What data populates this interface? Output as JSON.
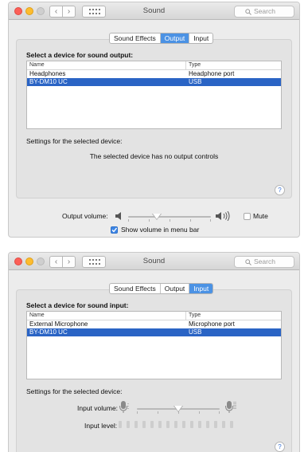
{
  "windows": [
    {
      "title": "Sound",
      "search_placeholder": "Search",
      "tabs": [
        {
          "label": "Sound Effects",
          "selected": false
        },
        {
          "label": "Output",
          "selected": true
        },
        {
          "label": "Input",
          "selected": false
        }
      ],
      "heading": "Select a device for sound output:",
      "columns": [
        "Name",
        "Type"
      ],
      "rows": [
        {
          "name": "Headphones",
          "type": "Headphone port",
          "selected": false
        },
        {
          "name": "BY-DM10 UC",
          "type": "USB",
          "selected": true
        }
      ],
      "settings_label": "Settings for the selected device:",
      "no_controls_text": "The selected device has no output controls",
      "help": "?",
      "output_volume": {
        "label": "Output volume:",
        "level": 0.35
      },
      "mute": {
        "label": "Mute",
        "checked": false
      },
      "show_volume": {
        "label": "Show volume in menu bar",
        "checked": true
      }
    },
    {
      "title": "Sound",
      "search_placeholder": "Search",
      "tabs": [
        {
          "label": "Sound Effects",
          "selected": false
        },
        {
          "label": "Output",
          "selected": false
        },
        {
          "label": "Input",
          "selected": true
        }
      ],
      "heading": "Select a device for sound input:",
      "columns": [
        "Name",
        "Type"
      ],
      "rows": [
        {
          "name": "External Microphone",
          "type": "Microphone port",
          "selected": false
        },
        {
          "name": "BY-DM10 UC",
          "type": "USB",
          "selected": true
        }
      ],
      "settings_label": "Settings for the selected device:",
      "input_volume": {
        "label": "Input volume:",
        "level": 0.5
      },
      "input_level": {
        "label": "Input level:",
        "segments": 15,
        "active": 0
      },
      "help": "?"
    }
  ],
  "colors": {
    "selection": "#2a64c5",
    "tab_selected": "#4b92e4",
    "checkbox_checked": "#3d86e6"
  }
}
